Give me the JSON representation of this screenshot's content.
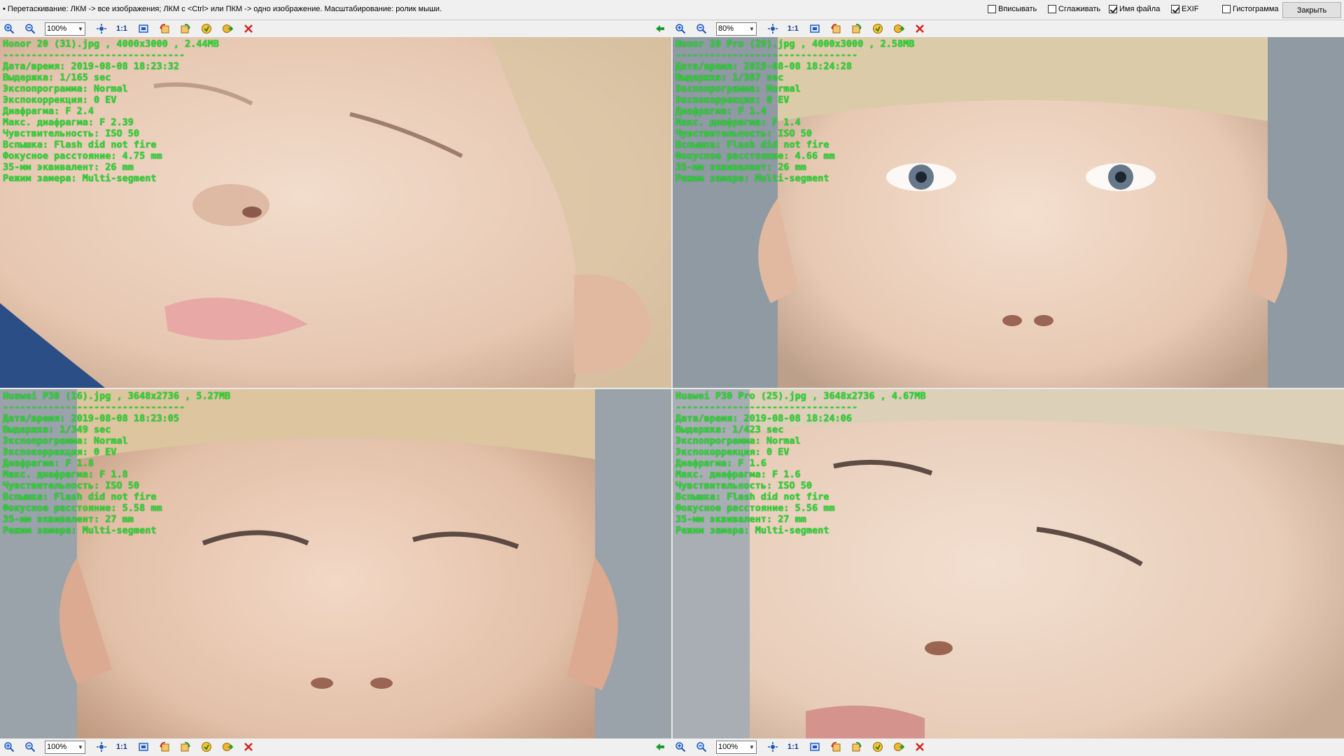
{
  "app": {
    "hint": "• Перетаскивание: ЛКМ -> все изображения; ЛКМ с <Ctrl> или ПКМ -> одно изображение. Масштабирование: ролик мыши.",
    "options": [
      {
        "label": "Вписывать",
        "checked": false
      },
      {
        "label": "Сглаживать",
        "checked": false
      },
      {
        "label": "Имя файла",
        "checked": true
      },
      {
        "label": "EXIF",
        "checked": true
      },
      {
        "label": "Гистограмма",
        "checked": false
      }
    ],
    "close_label": "Закрыть"
  },
  "toolbars": [
    {
      "zoom": "100%",
      "one_to_one": "1:1"
    },
    {
      "zoom": "80%",
      "one_to_one": "1:1"
    },
    {
      "zoom": "100%",
      "one_to_one": "1:1"
    },
    {
      "zoom": "100%",
      "one_to_one": "1:1"
    }
  ],
  "icons": [
    "zoom-in-icon",
    "zoom-out-icon",
    "fit-icon",
    "actual-size-icon",
    "fullscreen-icon",
    "rotate-left-icon",
    "rotate-right-icon",
    "save-icon",
    "copy-icon",
    "close-icon",
    "sync-arrow-icon"
  ],
  "panes": [
    {
      "header": "Honor 20 (31).jpg , 4000x3000 , 2.44MB",
      "separator": "--------------------------------",
      "lines": [
        "Дата/время: 2019-08-08 18:23:32",
        "Выдержка: 1/165 sec",
        "Экспопрограмма: Normal",
        "Экспокоррекция: 0 EV",
        "Диафрагма: F 2.4",
        "Макс. диафрагма: F 2.39",
        "Чувствительность: ISO 50",
        "Вспышка: Flash did not fire",
        "Фокусное расстояние: 4.75 mm",
        "35-мм эквивалент: 26 mm",
        "Режим замера: Multi-segment"
      ]
    },
    {
      "header": "Honor 20 Pro (29).jpg , 4000x3000 , 2.58MB",
      "separator": "--------------------------------",
      "lines": [
        "Дата/время: 2019-08-08 18:24:28",
        "Выдержка: 1/387 sec",
        "Экспопрограмма: Normal",
        "Экспокоррекция: 0 EV",
        "Диафрагма: F 1.4",
        "Макс. диафрагма: F 1.4",
        "Чувствительность: ISO 50",
        "Вспышка: Flash did not fire",
        "Фокусное расстояние: 4.66 mm",
        "35-мм эквивалент: 26 mm",
        "Режим замера: Multi-segment"
      ]
    },
    {
      "header": "Huawei P30 (16).jpg , 3648x2736 , 5.27MB",
      "separator": "--------------------------------",
      "lines": [
        "Дата/время: 2019-08-08 18:23:05",
        "Выдержка: 1/349 sec",
        "Экспопрограмма: Normal",
        "Экспокоррекция: 0 EV",
        "Диафрагма: F 1.8",
        "Макс. диафрагма: F 1.8",
        "Чувствительность: ISO 50",
        "Вспышка: Flash did not fire",
        "Фокусное расстояние: 5.58 mm",
        "35-мм эквивалент: 27 mm",
        "Режим замера: Multi-segment"
      ]
    },
    {
      "header": "Huawei P30 Pro (25).jpg , 3648x2736 , 4.67MB",
      "separator": "--------------------------------",
      "lines": [
        "Дата/время: 2019-08-08 18:24:06",
        "Выдержка: 1/423 sec",
        "Экспопрограмма: Normal",
        "Экспокоррекция: 0 EV",
        "Диафрагма: F 1.6",
        "Макс. диафрагма: F 1.6",
        "Чувствительность: ISO 50",
        "Вспышка: Flash did not fire",
        "Фокусное расстояние: 5.56 mm",
        "35-мм эквивалент: 27 mm",
        "Режим замера: Multi-segment"
      ]
    }
  ],
  "colors": {
    "exif_text": "#2bd92b",
    "skin": "#e8cbb7",
    "hair": "#d6c29a",
    "background_blur": "#8f9aa3"
  }
}
